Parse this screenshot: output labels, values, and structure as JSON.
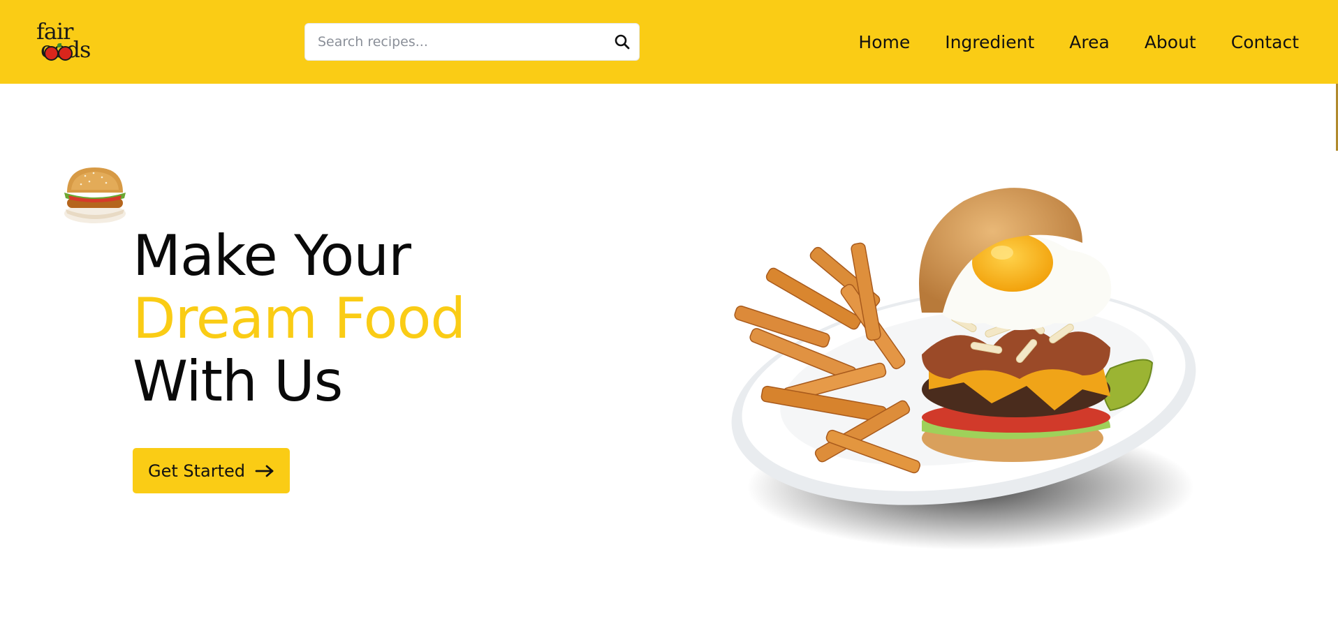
{
  "brand": {
    "logo_text_top": "fair",
    "logo_text_bottom": "oods",
    "logo_full": "fairfoods"
  },
  "search": {
    "placeholder": "Search recipes...",
    "value": "",
    "icon": "search-icon"
  },
  "nav": {
    "items": [
      {
        "label": "Home"
      },
      {
        "label": "Ingredient"
      },
      {
        "label": "Area"
      },
      {
        "label": "About"
      },
      {
        "label": "Contact"
      }
    ]
  },
  "hero": {
    "line1": "Make Your",
    "line2": "Dream Food",
    "line3": "With Us",
    "cta_label": "Get Started",
    "cta_icon": "arrow-right-icon",
    "hero_image": "burger-fries-plate-image",
    "decor_image": "small-burger-image"
  },
  "colors": {
    "accent": "#facc15",
    "text": "#0a0a0a",
    "background": "#ffffff"
  }
}
